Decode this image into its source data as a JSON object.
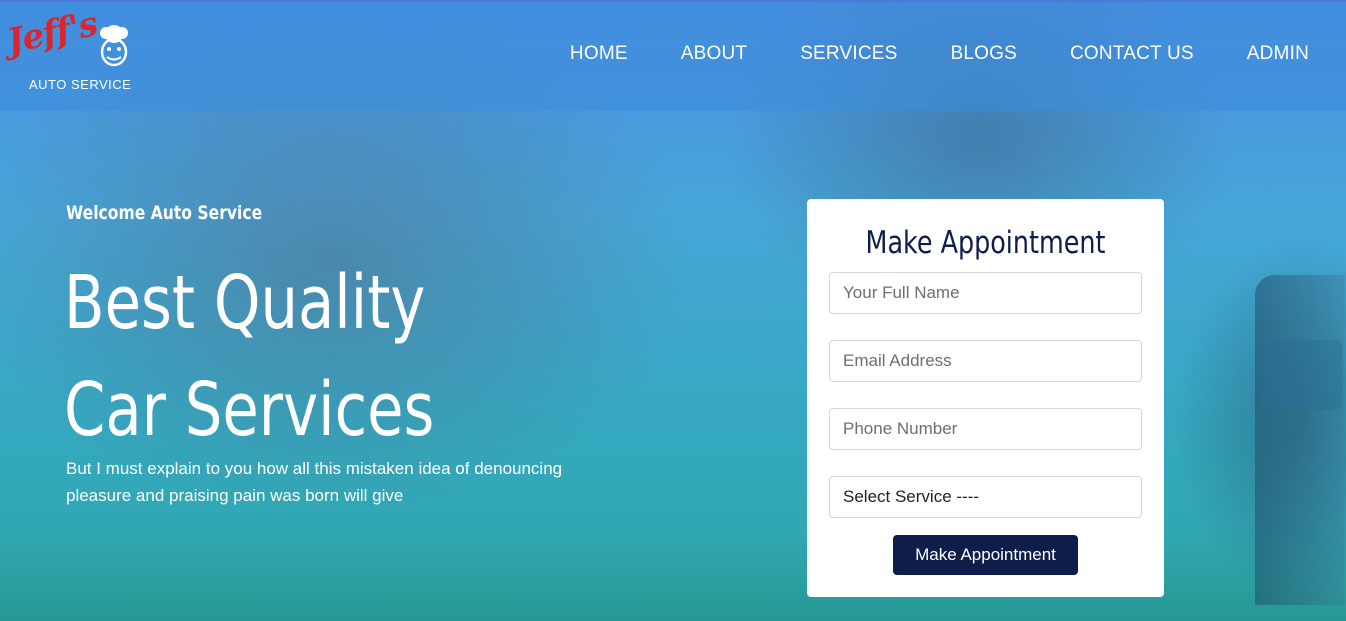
{
  "brand": {
    "logo_script": "Jeff's",
    "logo_sub": "AUTO SERVICE",
    "accent": "#d8262c"
  },
  "nav": {
    "items": [
      "HOME",
      "ABOUT",
      "SERVICES",
      "BLOGS",
      "CONTACT US",
      "ADMIN"
    ]
  },
  "hero": {
    "welcome": "Welcome Auto Service",
    "headline_line1": "Best Quality",
    "headline_line2": "Car Services",
    "lead": "But I must explain to you how all this mistaken idea of denouncing pleasure and praising pain was born will give"
  },
  "appointment": {
    "title": "Make Appointment",
    "name_placeholder": "Your Full Name",
    "email_placeholder": "Email Address",
    "phone_placeholder": "Phone Number",
    "service_selected": "Select Service ----",
    "submit_label": "Make Appointment",
    "button_color": "#0f1d4a"
  }
}
